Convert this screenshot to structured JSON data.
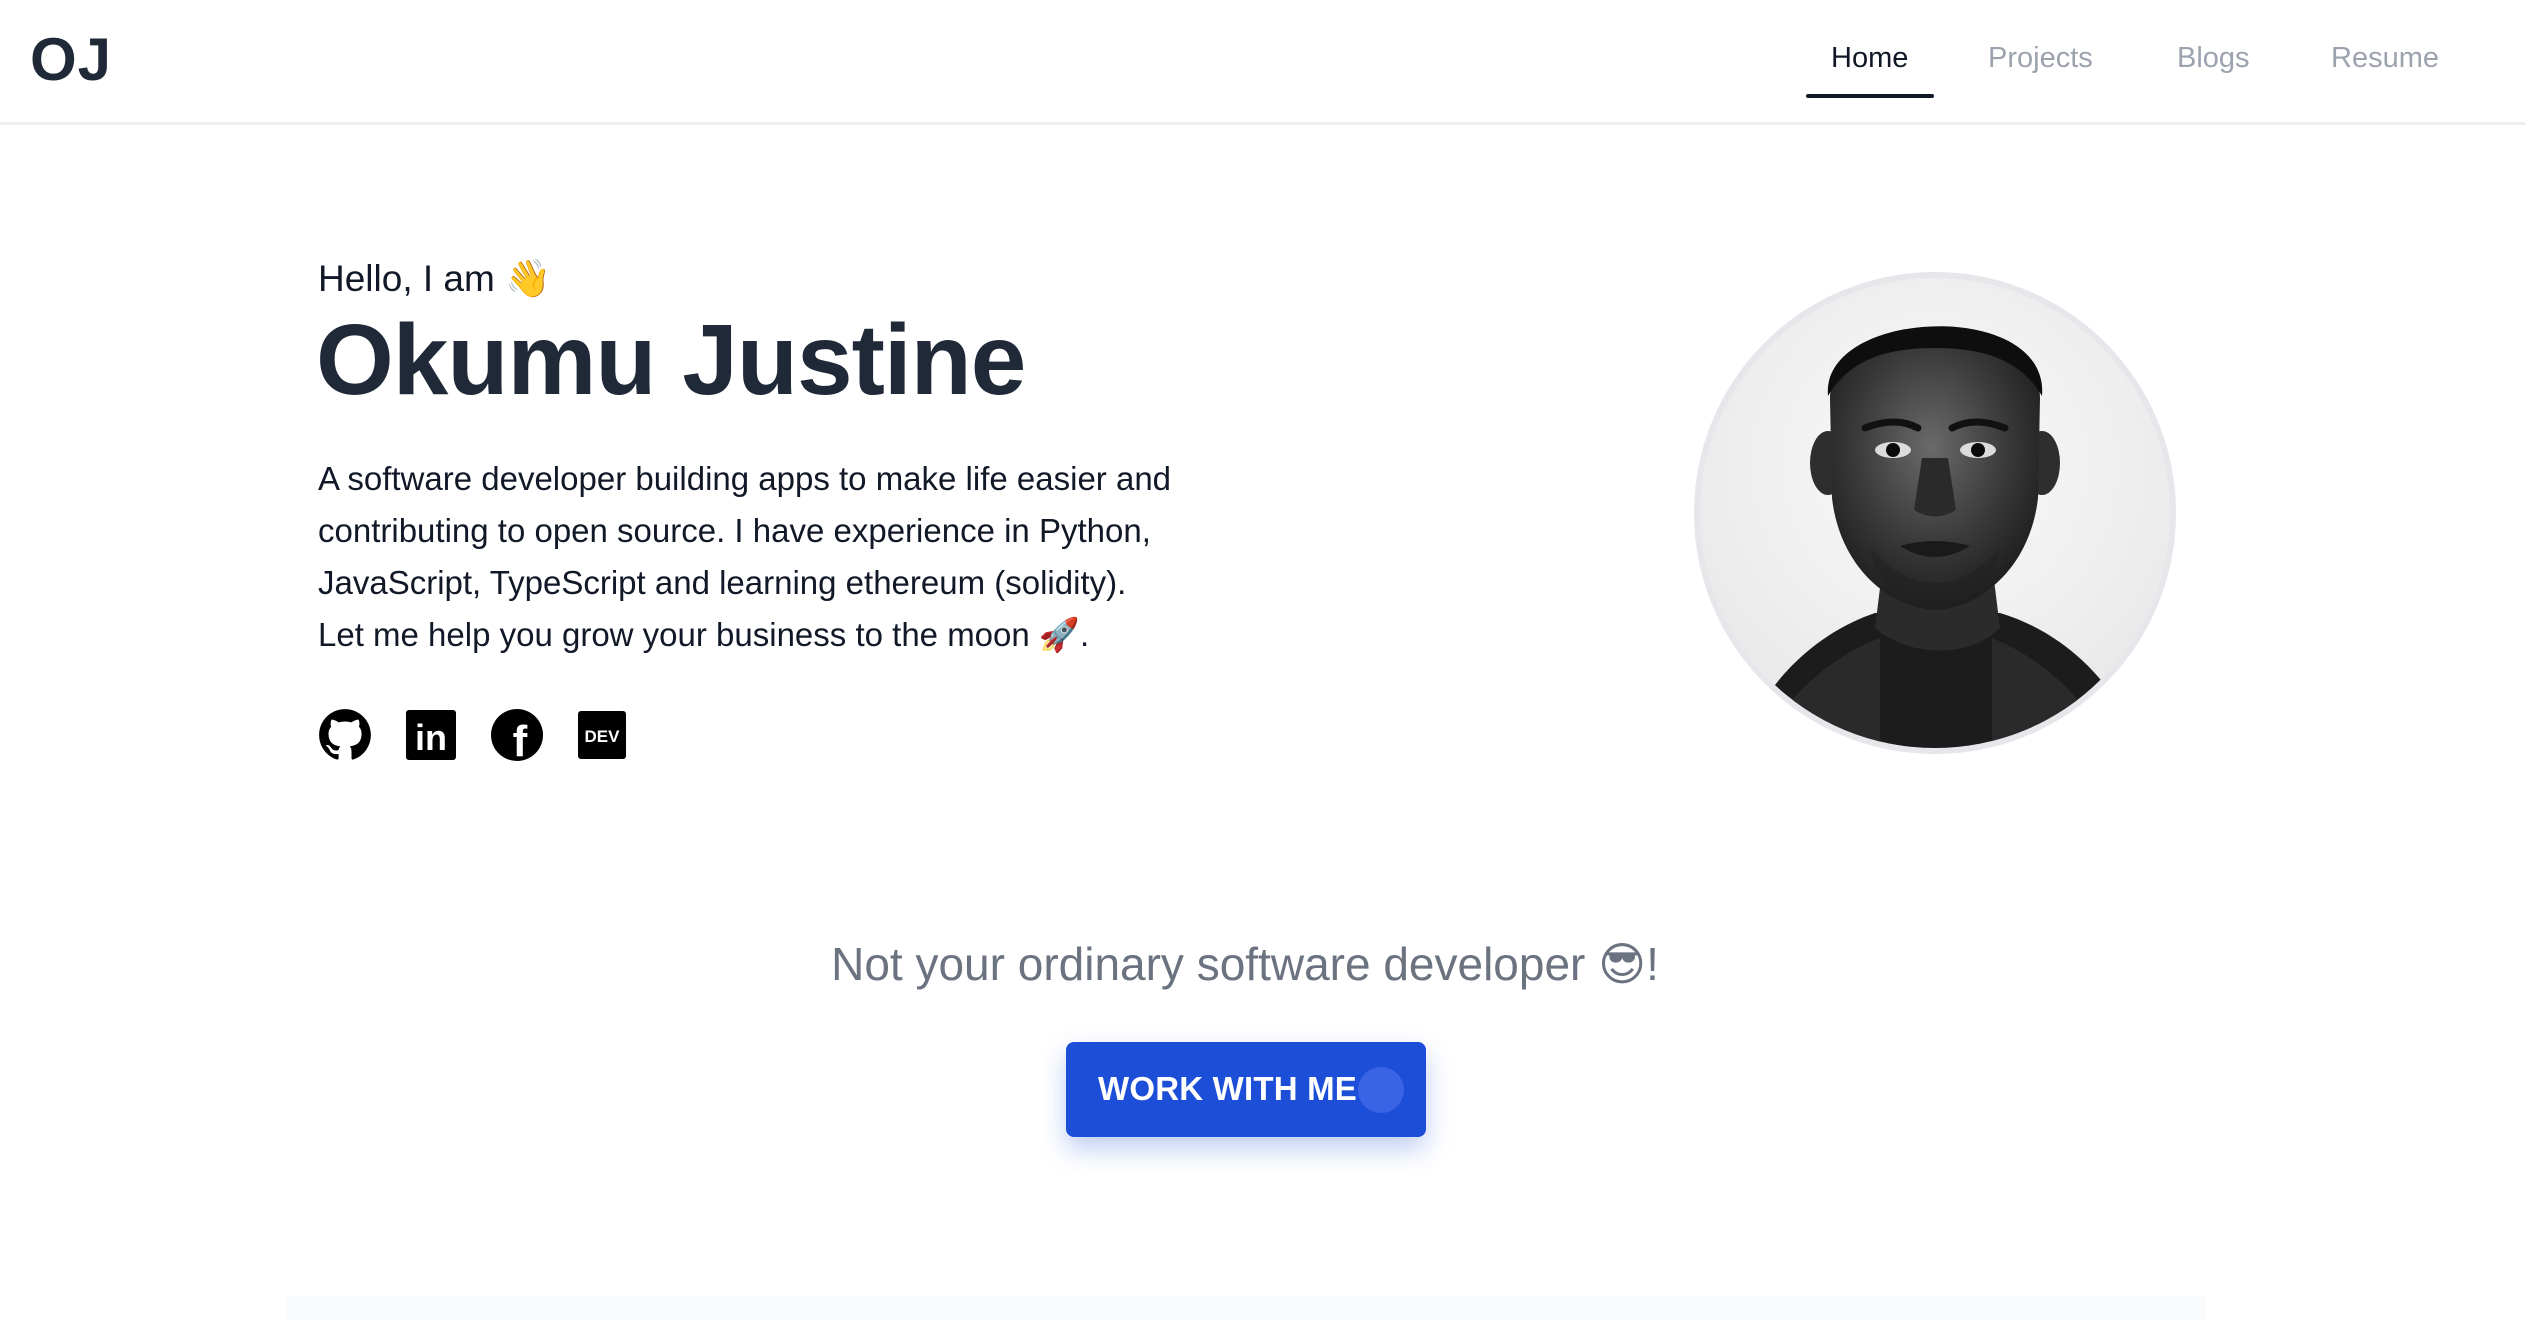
{
  "header": {
    "logo": "OJ",
    "nav": [
      {
        "label": "Home",
        "active": true
      },
      {
        "label": "Projects",
        "active": false
      },
      {
        "label": "Blogs",
        "active": false
      },
      {
        "label": "Resume",
        "active": false
      }
    ]
  },
  "hero": {
    "greeting": "Hello, I am 👋",
    "name": "Okumu Justine",
    "bio_lines": [
      "A software developer building apps to make life easier and",
      "contributing to open source. I have experience in Python,",
      "JavaScript, TypeScript and learning ethereum (solidity).",
      "Let me help you grow your business to the moon 🚀."
    ],
    "socials": [
      {
        "icon": "github-icon"
      },
      {
        "icon": "linkedin-icon",
        "text": "in"
      },
      {
        "icon": "facebook-icon",
        "text": "f"
      },
      {
        "icon": "dev-icon",
        "text": "DEV"
      }
    ]
  },
  "tagline": "Not your ordinary software developer 😎!",
  "cta": {
    "label": "WORK WITH ME"
  },
  "colors": {
    "accent": "#1d4ed8",
    "text_dark": "#1f2937",
    "nav_inactive": "#9ca3af",
    "tagline": "#6b7280"
  }
}
